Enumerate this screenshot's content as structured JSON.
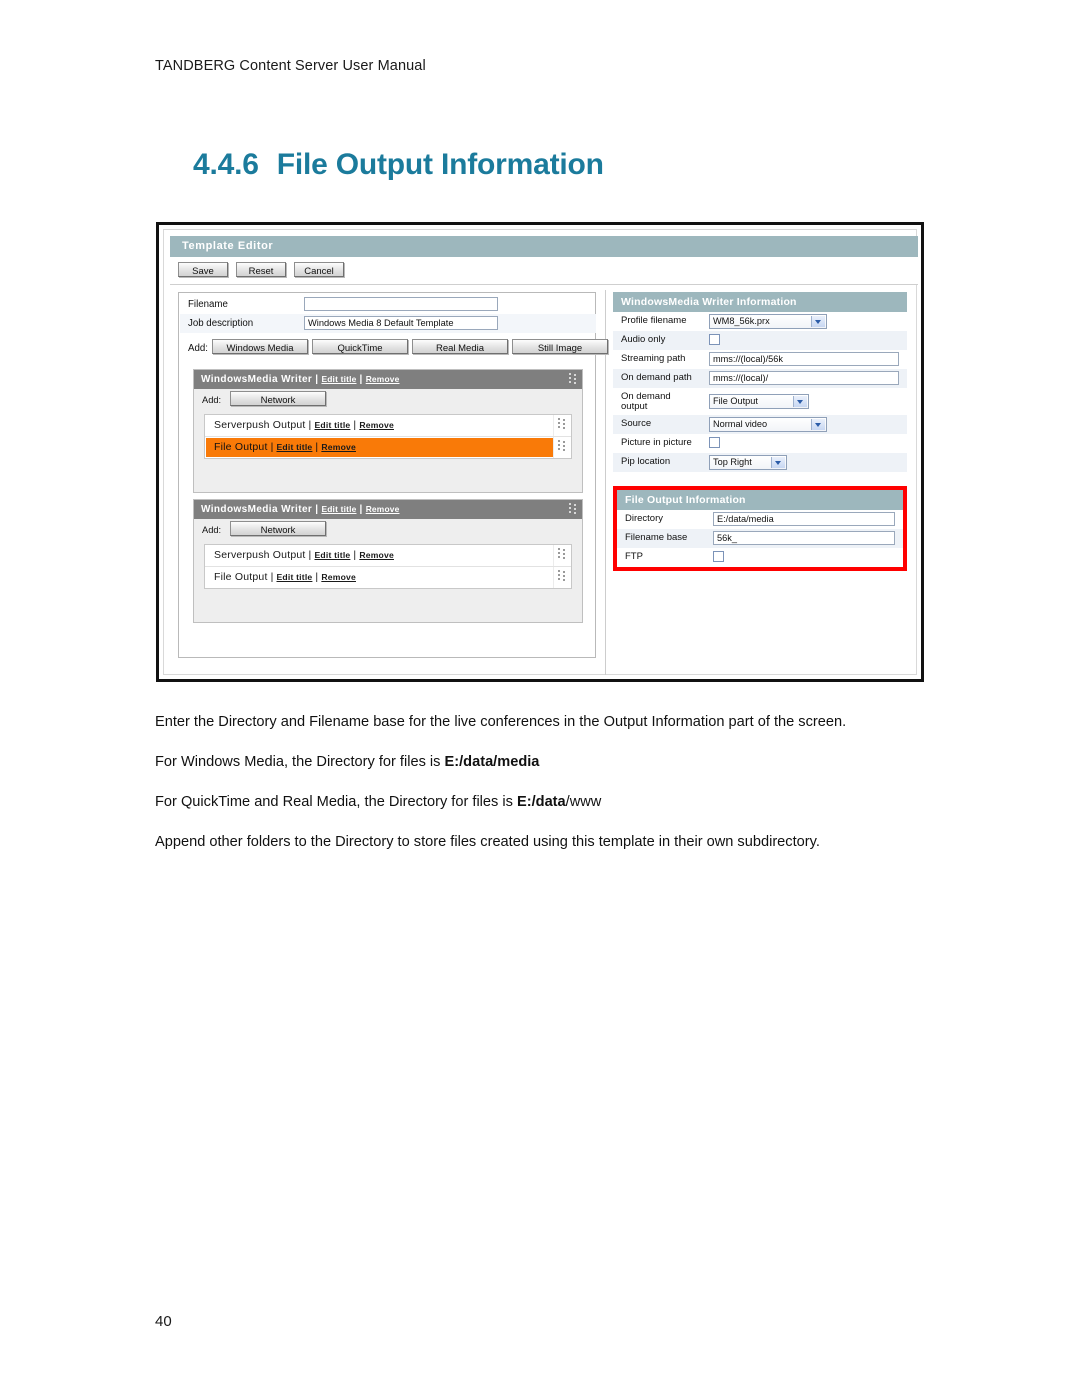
{
  "document": {
    "header": "TANDBERG Content Server User Manual",
    "page_number": "40",
    "section_number": "4.4.6",
    "section_title": "File Output Information",
    "accent_color": "#1b7b9c"
  },
  "body": {
    "p1": "Enter the Directory and Filename base for the live conferences in the Output Information part of the screen.",
    "p2_pre": "For Windows Media, the Directory for files is ",
    "p2_bold": "E:/data/media",
    "p3_pre": "For QuickTime and Real Media, the Directory for files is ",
    "p3_bold": "E:/data",
    "p3_post": "/www",
    "p4": "Append other folders to the Directory to store files created using this template in their own subdirectory."
  },
  "screenshot": {
    "window_title": "Template Editor",
    "toolbar": {
      "save_label": "Save",
      "reset_label": "Reset",
      "cancel_label": "Cancel"
    },
    "form": {
      "filename_label": "Filename",
      "filename_value": "",
      "jobdesc_label": "Job description",
      "jobdesc_value": "Windows Media 8 Default Template",
      "add_label": "Add:",
      "add_buttons": [
        "Windows Media",
        "QuickTime",
        "Real Media",
        "Still Image"
      ]
    },
    "writers": [
      {
        "title": "WindowsMedia Writer",
        "edit_title": "Edit title",
        "remove": "Remove",
        "add_label": "Add:",
        "add_button": "Network",
        "outputs": [
          {
            "name": "Serverpush Output",
            "edit_title": "Edit title",
            "remove": "Remove",
            "selected": false
          },
          {
            "name": "File Output",
            "edit_title": "Edit title",
            "remove": "Remove",
            "selected": true
          }
        ]
      },
      {
        "title": "WindowsMedia Writer",
        "edit_title": "Edit title",
        "remove": "Remove",
        "add_label": "Add:",
        "add_button": "Network",
        "outputs": [
          {
            "name": "Serverpush Output",
            "edit_title": "Edit title",
            "remove": "Remove",
            "selected": false
          },
          {
            "name": "File Output",
            "edit_title": "Edit title",
            "remove": "Remove",
            "selected": false
          }
        ]
      }
    ],
    "writer_info": {
      "heading": "WindowsMedia Writer Information",
      "profile_filename_label": "Profile filename",
      "profile_filename_value": "WM8_56k.prx",
      "audio_only_label": "Audio only",
      "audio_only_checked": false,
      "streaming_path_label": "Streaming path",
      "streaming_path_value": "mms://(local)/56k",
      "on_demand_path_label": "On demand path",
      "on_demand_path_value": "mms://(local)/",
      "on_demand_output_label": "On demand output",
      "on_demand_output_value": "File Output",
      "source_label": "Source",
      "source_value": "Normal video",
      "pip_label": "Picture in picture",
      "pip_checked": false,
      "pip_location_label": "Pip location",
      "pip_location_value": "Top Right"
    },
    "file_output_info": {
      "heading": "File Output Information",
      "directory_label": "Directory",
      "directory_value": "E:/data/media",
      "filename_base_label": "Filename base",
      "filename_base_value": "56k_",
      "ftp_label": "FTP",
      "ftp_checked": false,
      "highlight_color": "#ff0000"
    },
    "colors": {
      "titlebar": "#9db7bd",
      "writer_header": "#7f7f7f",
      "selected_row": "#f97a08"
    }
  }
}
